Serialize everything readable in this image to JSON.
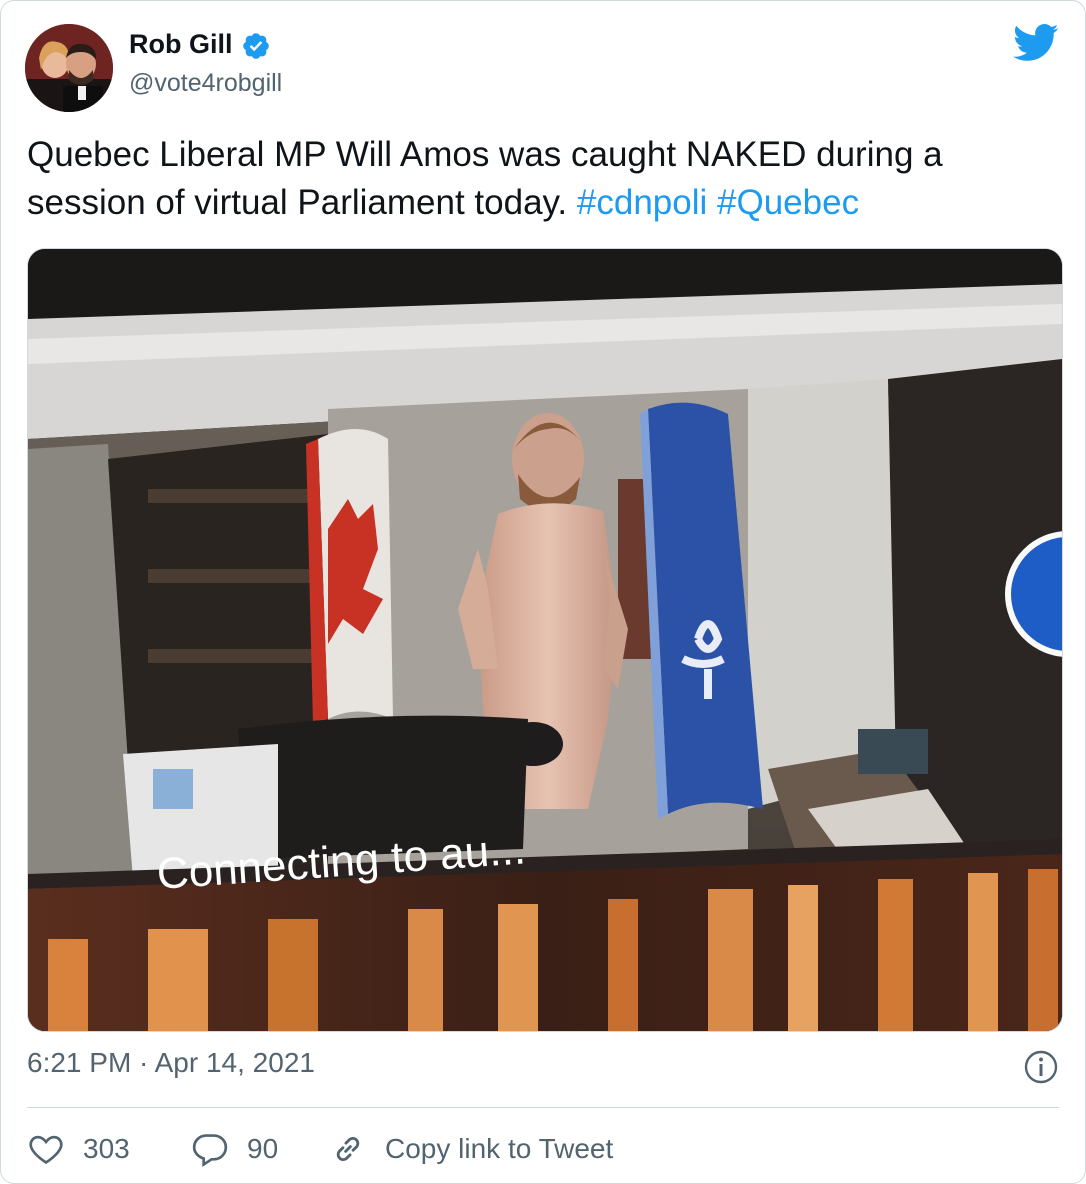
{
  "author": {
    "display_name": "Rob Gill",
    "handle": "@vote4robgill",
    "verified": true
  },
  "tweet": {
    "text": "Quebec Liberal MP Will Amos was caught NAKED during a session of virtual Parliament today.",
    "hashtags": [
      "#cdnpoli",
      "#Quebec"
    ]
  },
  "media": {
    "overlay_text": "Connecting to au..."
  },
  "meta": {
    "timestamp": "6:21 PM · Apr 14, 2021"
  },
  "actions": {
    "likes": "303",
    "replies": "90",
    "copy_link_label": "Copy link to Tweet"
  },
  "colors": {
    "accent": "#1d9bf0",
    "secondary_text": "#536471",
    "primary_text": "#0f1419"
  },
  "icons": [
    "verified-badge-icon",
    "twitter-bird-icon",
    "info-icon",
    "heart-icon",
    "reply-bubble-icon",
    "link-icon"
  ]
}
